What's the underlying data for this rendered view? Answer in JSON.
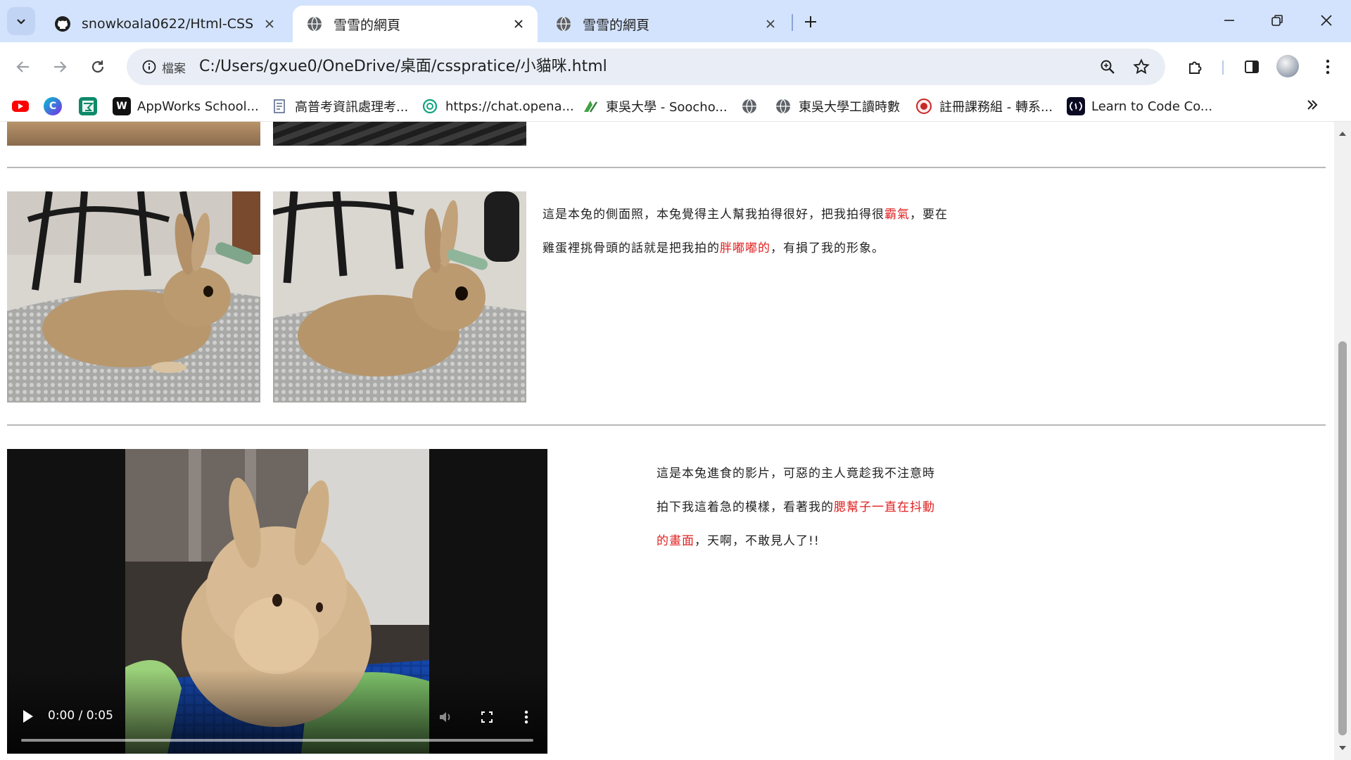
{
  "browser": {
    "tabs": [
      {
        "title": "snowkoala0622/Html-CSS",
        "favicon": "github-icon",
        "active": false
      },
      {
        "title": "雪雪的網頁",
        "favicon": "globe-icon",
        "active": true
      },
      {
        "title": "雪雪的網頁",
        "favicon": "globe-icon",
        "active": false
      }
    ],
    "address": {
      "chip_label": "檔案",
      "url": "C:/Users/gxue0/OneDrive/桌面/csspratice/小貓咪.html"
    },
    "bookmarks": [
      {
        "label": "",
        "icon": "youtube-icon",
        "color": "#ff0000"
      },
      {
        "label": "",
        "icon": "canva-icon",
        "color": "#7d2ae8"
      },
      {
        "label": "",
        "icon": "bookmark-app-icon",
        "color": "#0e8a6a"
      },
      {
        "label": "AppWorks School...",
        "icon": "appworks-icon",
        "color": "#111111"
      },
      {
        "label": "高普考資訊處理考...",
        "icon": "document-icon",
        "color": "#5b6b8c"
      },
      {
        "label": "https://chat.opena...",
        "icon": "openai-icon",
        "color": "#10a37f"
      },
      {
        "label": "東吳大學 - Soocho...",
        "icon": "soochow-icon",
        "color": "#2e7d32"
      },
      {
        "label": "",
        "icon": "globe-icon",
        "color": "#5f6368"
      },
      {
        "label": "東吳大學工讀時數",
        "icon": "globe-icon",
        "color": "#5f6368"
      },
      {
        "label": "註冊課務組 - 轉系...",
        "icon": "registrar-icon",
        "color": "#c62828"
      },
      {
        "label": "Learn to Code  Co...",
        "icon": "freecodecamp-icon",
        "color": "#0a0a23"
      }
    ]
  },
  "page": {
    "section1": {
      "text_before_red1": "這是本兔的側面照，本兔覺得主人幫我拍得很好，把我拍得很",
      "red1": "霸氣",
      "text_after_red1": "，要在",
      "line2_before_red": "雞蛋裡挑骨頭的話就是把我拍的",
      "red2": "胖嘟嘟的",
      "line2_after_red": "，有損了我的形象。"
    },
    "section2": {
      "line1": "這是本兔進食的影片，可惡的主人竟趁我不注意時",
      "line2_before_red": "拍下我這着急的模樣，看著我的",
      "red1": "腮幫子一直在抖動",
      "red2": "的畫面",
      "line3_after_red": "，天啊，不敢見人了!!"
    },
    "video": {
      "time": "0:00 / 0:05",
      "progress_fraction": 0
    }
  }
}
